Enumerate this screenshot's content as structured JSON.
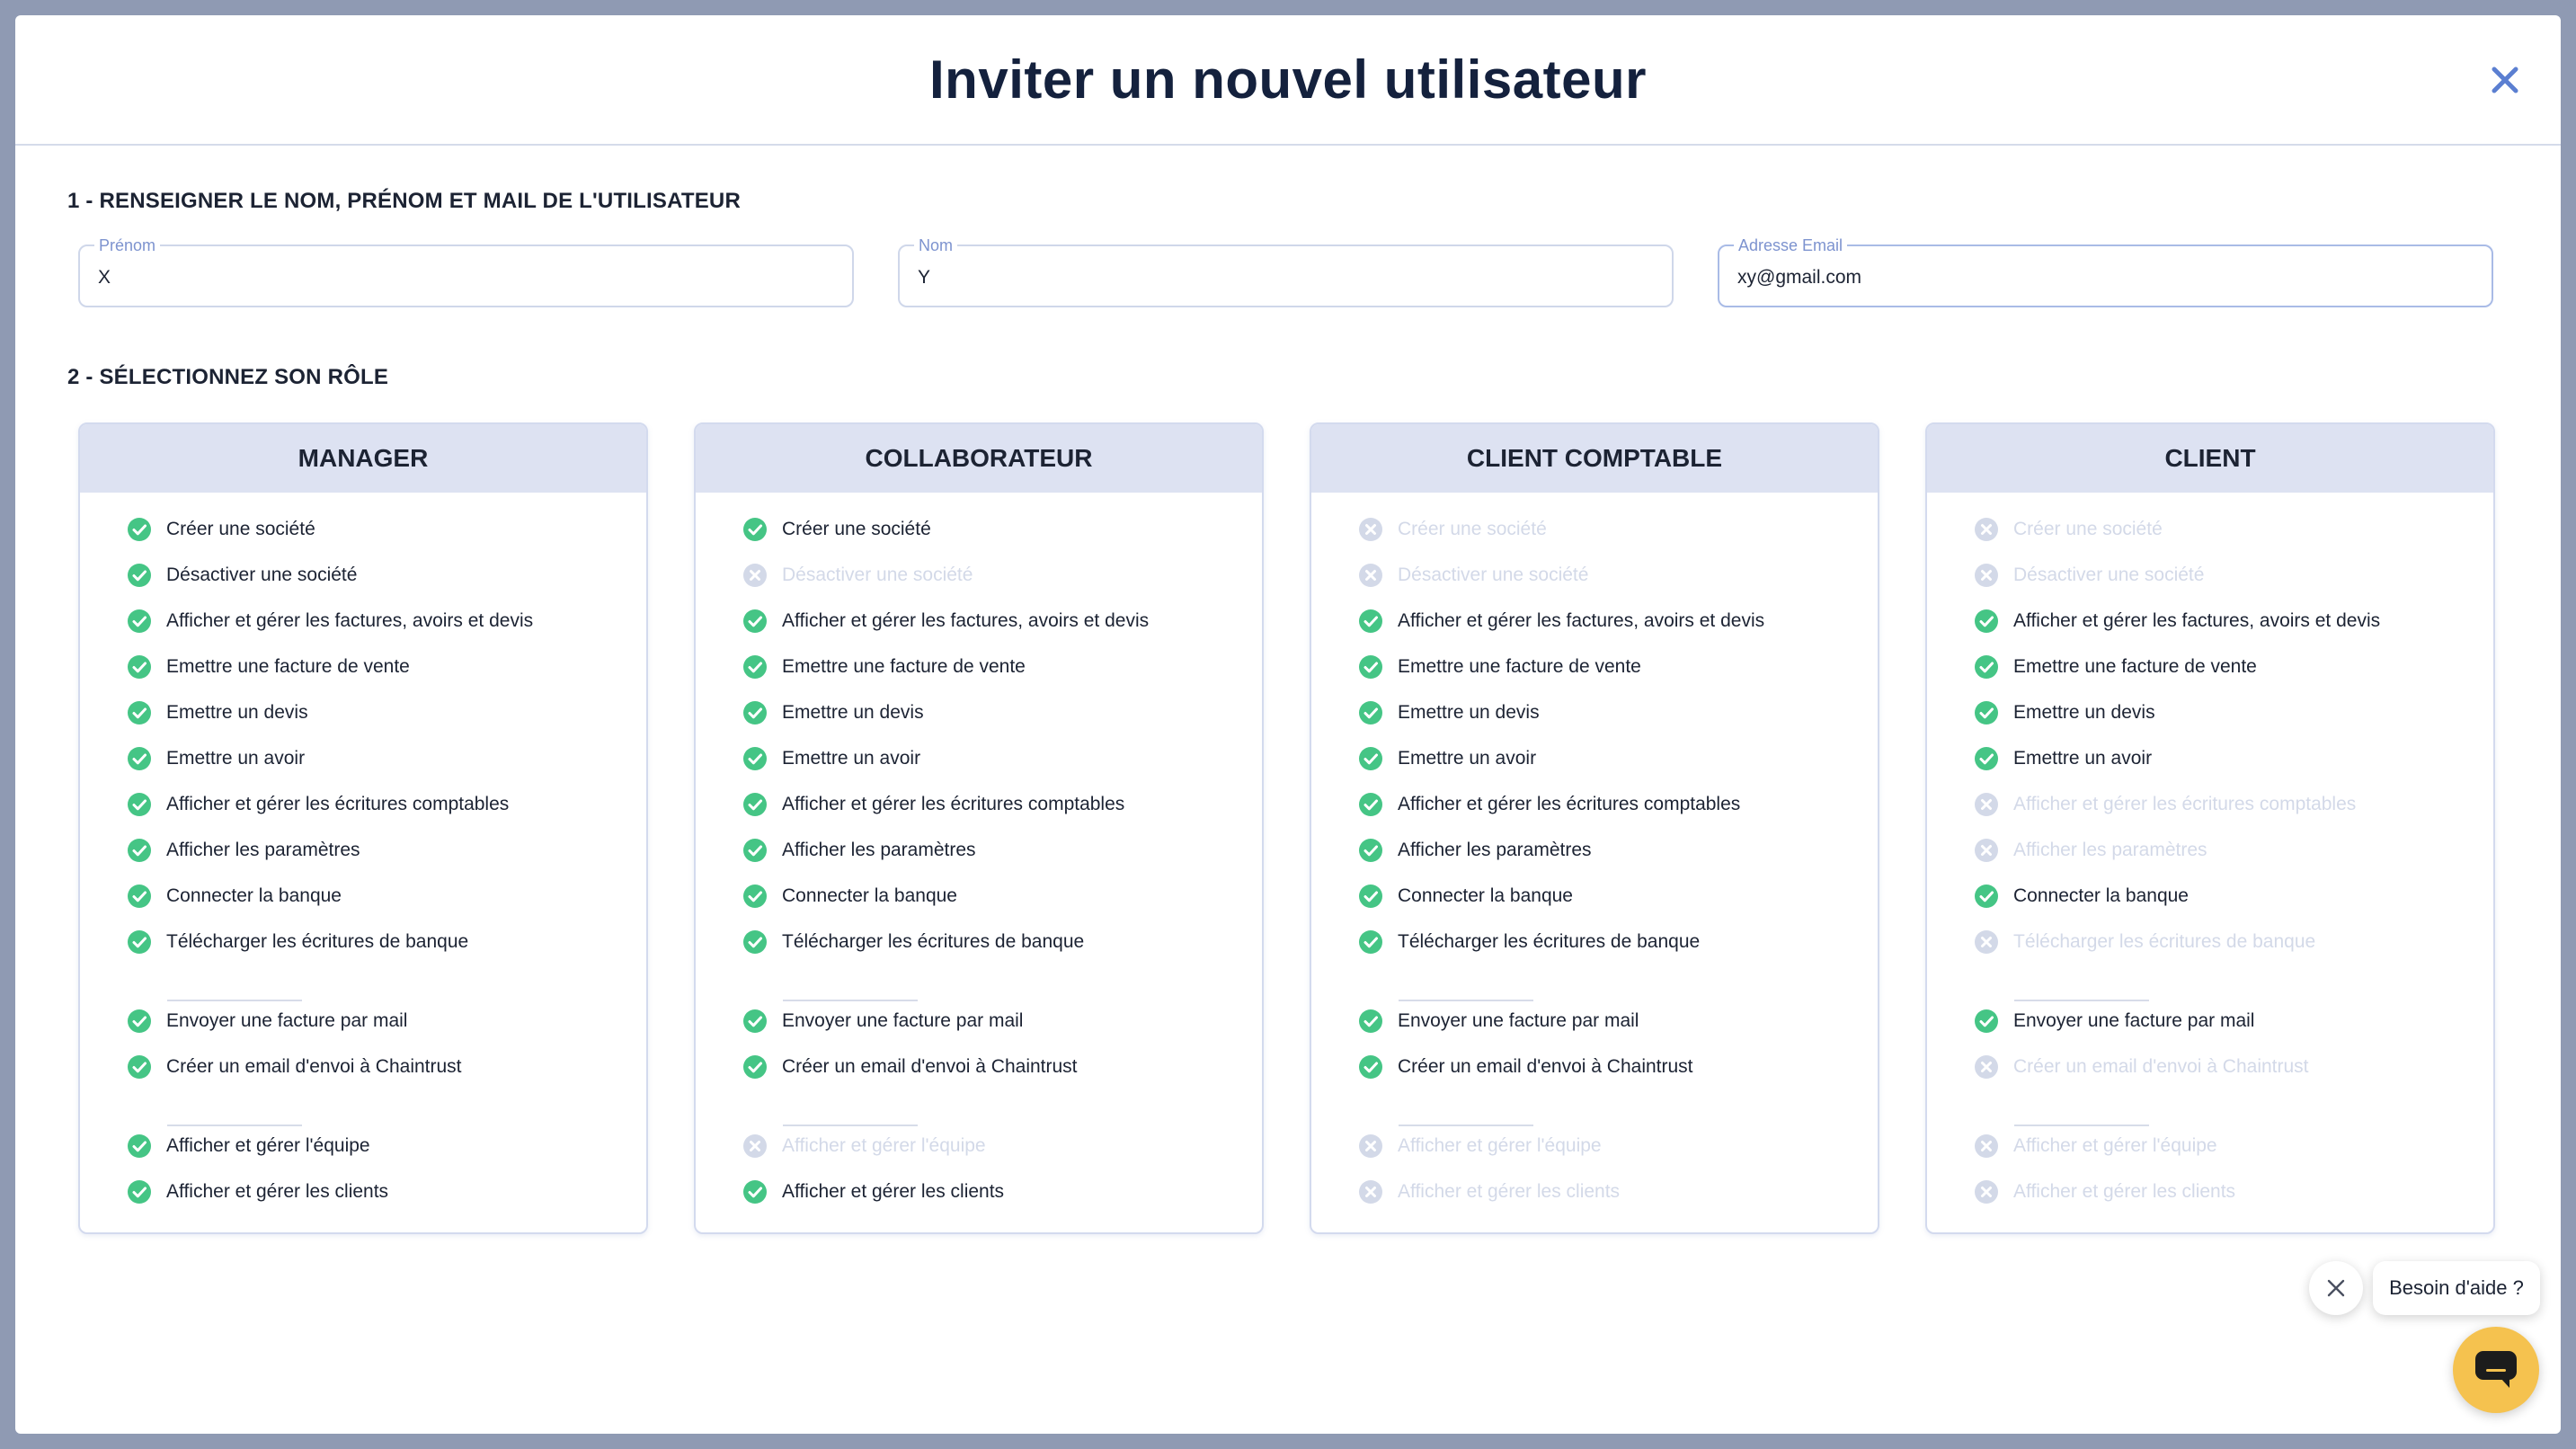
{
  "modal": {
    "title": "Inviter un nouvel utilisateur"
  },
  "step1": {
    "title": "1 - RENSEIGNER LE NOM, PRÉNOM ET MAIL DE L'UTILISATEUR",
    "fields": {
      "firstname": {
        "label": "Prénom",
        "value": "X"
      },
      "lastname": {
        "label": "Nom",
        "value": "Y"
      },
      "email": {
        "label": "Adresse Email",
        "value": "xy@gmail.com"
      }
    }
  },
  "step2": {
    "title": "2 - SÉLECTIONNEZ SON RÔLE"
  },
  "permissions": [
    "Créer une société",
    "Désactiver une société",
    "Afficher et gérer les factures, avoirs et devis",
    "Emettre une facture de vente",
    "Emettre un devis",
    "Emettre un avoir",
    "Afficher et gérer les écritures comptables",
    "Afficher les paramètres",
    "Connecter la banque",
    "Télécharger les écritures de banque",
    "Envoyer une facture par mail",
    "Créer un email d'envoi à Chaintrust",
    "Afficher et gérer l'équipe",
    "Afficher et gérer les clients"
  ],
  "roles": [
    {
      "name": "MANAGER",
      "granted": [
        true,
        true,
        true,
        true,
        true,
        true,
        true,
        true,
        true,
        true,
        true,
        true,
        true,
        true
      ]
    },
    {
      "name": "COLLABORATEUR",
      "granted": [
        true,
        false,
        true,
        true,
        true,
        true,
        true,
        true,
        true,
        true,
        true,
        true,
        false,
        true
      ]
    },
    {
      "name": "CLIENT COMPTABLE",
      "granted": [
        false,
        false,
        true,
        true,
        true,
        true,
        true,
        true,
        true,
        true,
        true,
        true,
        false,
        false
      ]
    },
    {
      "name": "CLIENT",
      "granted": [
        false,
        false,
        true,
        true,
        true,
        true,
        false,
        false,
        true,
        false,
        true,
        false,
        false,
        false
      ]
    }
  ],
  "help": {
    "bubble_text": "Besoin d'aide ?"
  },
  "icons": {
    "close": "close-icon",
    "granted": "check-circle-icon",
    "denied": "x-circle-icon",
    "chat": "chat-icon"
  },
  "colors": {
    "title": "#14213d",
    "close": "#5b7fd1",
    "check": "#45c585",
    "denied": "#d3d9e8",
    "card_header": "#dde2f2",
    "chat_button": "#f5c24f",
    "overlay": "#8f9ab3"
  }
}
